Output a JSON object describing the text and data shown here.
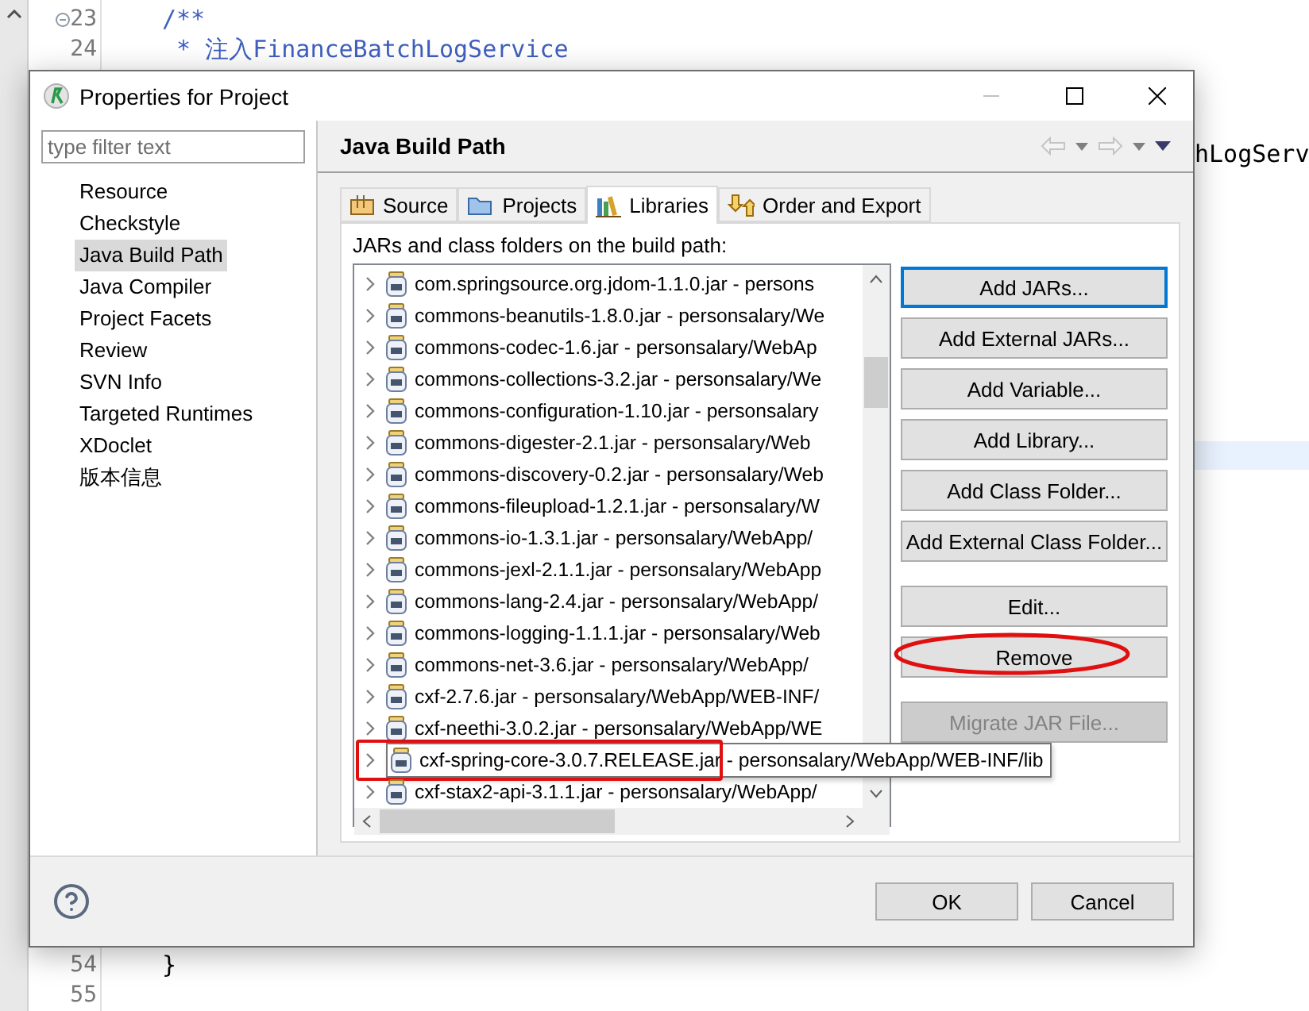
{
  "editor": {
    "top_lines": [
      {
        "number": "23",
        "code": "/**",
        "fold": true
      },
      {
        "number": "24",
        "code": " * 注入FinanceBatchLogService",
        "fold": false
      }
    ],
    "side_fragment": "hLogServ",
    "bottom_lines": [
      {
        "number": "54",
        "code": "}",
        "fold": false
      },
      {
        "number": "55",
        "fold": false
      }
    ]
  },
  "dialog": {
    "title": "Properties for Project",
    "filter": {
      "placeholder": "type filter text"
    },
    "sidebar": {
      "items": [
        {
          "label": "Resource",
          "selected": false
        },
        {
          "label": "Checkstyle",
          "selected": false
        },
        {
          "label": "Java Build Path",
          "selected": true
        },
        {
          "label": "Java Compiler",
          "selected": false
        },
        {
          "label": "Project Facets",
          "selected": false
        },
        {
          "label": "Review",
          "selected": false
        },
        {
          "label": "SVN Info",
          "selected": false
        },
        {
          "label": "Targeted Runtimes",
          "selected": false
        },
        {
          "label": "XDoclet",
          "selected": false
        },
        {
          "label": "版本信息",
          "selected": false
        }
      ]
    },
    "page_title": "Java Build Path",
    "tabs": [
      {
        "label": "Source",
        "kind": "source",
        "selected": false
      },
      {
        "label": "Projects",
        "kind": "projects",
        "selected": false
      },
      {
        "label": "Libraries",
        "kind": "libraries",
        "selected": true
      },
      {
        "label": "Order and Export",
        "kind": "order",
        "selected": false
      }
    ],
    "list_label": "JARs and class folders on the build path:",
    "libraries": [
      {
        "text": "com.springsource.org.jdom-1.1.0.jar - persons",
        "highlighted": false
      },
      {
        "text": "commons-beanutils-1.8.0.jar - personsalary/We",
        "highlighted": false
      },
      {
        "text": "commons-codec-1.6.jar - personsalary/WebAp",
        "highlighted": false
      },
      {
        "text": "commons-collections-3.2.jar - personsalary/We",
        "highlighted": false
      },
      {
        "text": "commons-configuration-1.10.jar - personsalary",
        "highlighted": false
      },
      {
        "text": "commons-digester-2.1.jar - personsalary/Web",
        "highlighted": false
      },
      {
        "text": "commons-discovery-0.2.jar - personsalary/Web",
        "highlighted": false
      },
      {
        "text": "commons-fileupload-1.2.1.jar - personsalary/W",
        "highlighted": false
      },
      {
        "text": "commons-io-1.3.1.jar - personsalary/WebApp/",
        "highlighted": false
      },
      {
        "text": "commons-jexl-2.1.1.jar - personsalary/WebApp",
        "highlighted": false
      },
      {
        "text": "commons-lang-2.4.jar - personsalary/WebApp/",
        "highlighted": false
      },
      {
        "text": "commons-logging-1.1.1.jar - personsalary/Web",
        "highlighted": false
      },
      {
        "text": "commons-net-3.6.jar - personsalary/WebApp/",
        "highlighted": false
      },
      {
        "text": "cxf-2.7.6.jar - personsalary/WebApp/WEB-INF/",
        "highlighted": false
      },
      {
        "text": "cxf-neethi-3.0.2.jar - personsalary/WebApp/WE",
        "highlighted": false
      },
      {
        "text": "cxf-spring-core-3.0.7.RELEASE.jar - personsalary/WebApp/WEB-INF/lib",
        "highlighted": true
      },
      {
        "text": "cxf-stax2-api-3.1.1.jar - personsalary/WebApp/",
        "highlighted": false
      }
    ],
    "button_groups": [
      [
        {
          "label": "Add JARs...",
          "disabled": false,
          "focused": true,
          "circled": false
        },
        {
          "label": "Add External JARs...",
          "disabled": false,
          "focused": false,
          "circled": false
        },
        {
          "label": "Add Variable...",
          "disabled": false,
          "focused": false,
          "circled": false
        },
        {
          "label": "Add Library...",
          "disabled": false,
          "focused": false,
          "circled": false
        },
        {
          "label": "Add Class Folder...",
          "disabled": false,
          "focused": false,
          "circled": false
        },
        {
          "label": "Add External Class Folder...",
          "disabled": false,
          "focused": false,
          "circled": false
        }
      ],
      [
        {
          "label": "Edit...",
          "disabled": false,
          "focused": false,
          "circled": false
        },
        {
          "label": "Remove",
          "disabled": false,
          "focused": false,
          "circled": true
        }
      ],
      [
        {
          "label": "Migrate JAR File...",
          "disabled": true,
          "focused": false,
          "circled": false
        }
      ]
    ],
    "footer_buttons": [
      {
        "label": "OK"
      },
      {
        "label": "Cancel"
      }
    ]
  }
}
